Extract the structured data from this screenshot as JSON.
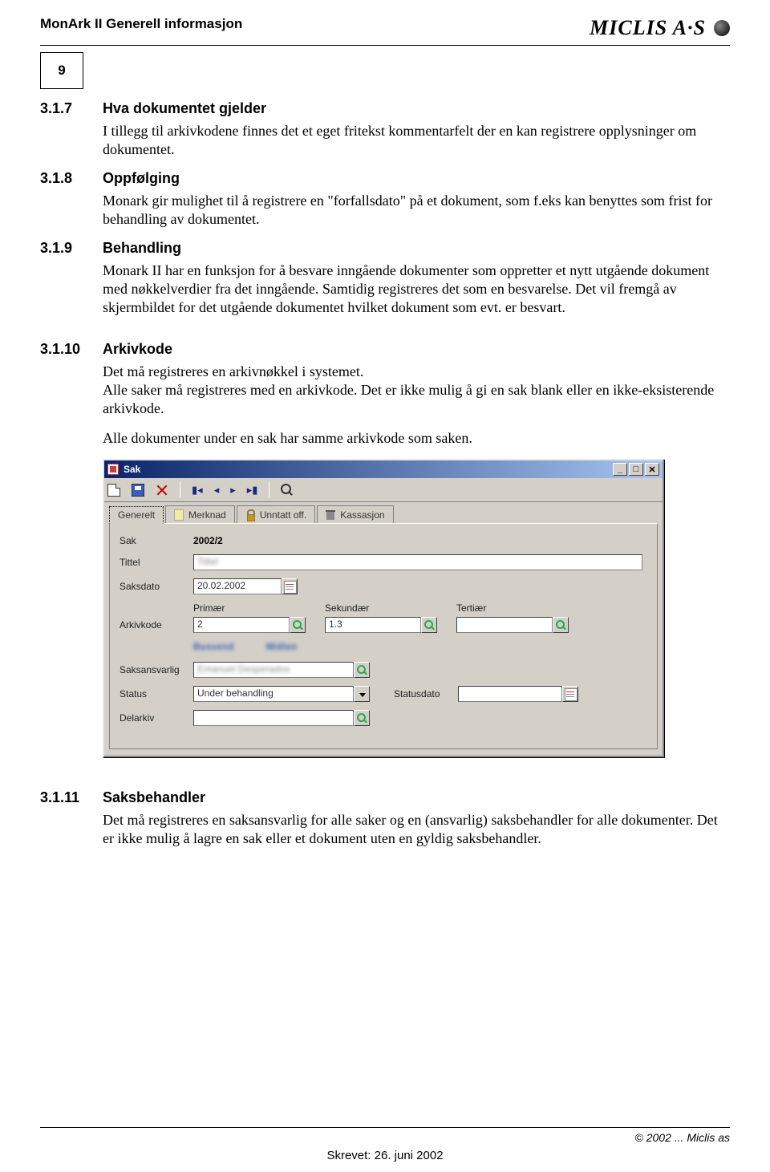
{
  "header": {
    "left": "MonArk II  Generell informasjon",
    "logo_text": "MICLIS A·S",
    "page_number": "9"
  },
  "sections": [
    {
      "num": "3.1.7",
      "title": "Hva dokumentet gjelder",
      "paras": [
        "I tillegg til arkivkodene finnes det et eget fritekst kommentarfelt der en kan registrere opplysninger om dokumentet."
      ]
    },
    {
      "num": "3.1.8",
      "title": "Oppfølging",
      "paras": [
        "Monark gir mulighet til å registrere en \"forfallsdato\" på et dokument, som f.eks kan benyttes som frist for behandling av dokumentet."
      ]
    },
    {
      "num": "3.1.9",
      "title": "Behandling",
      "paras": [
        "Monark II har en funksjon for å besvare inngående dokumenter som oppretter et nytt utgående dokument med nøkkelverdier fra det inngående. Samtidig registreres det som en besvarelse. Det vil fremgå av skjermbildet for det utgående dokumentet hvilket dokument som evt. er besvart."
      ]
    },
    {
      "num": "3.1.10",
      "title": "Arkivkode",
      "paras": [
        "Det må registreres en arkivnøkkel i systemet.",
        "Alle saker må registreres med en arkivkode. Det er ikke mulig å gi en sak blank eller en ikke-eksisterende arkivkode.",
        "Alle dokumenter under en sak har samme arkivkode som saken."
      ]
    },
    {
      "num": "3.1.11",
      "title": "Saksbehandler",
      "paras": [
        "Det må registreres en saksansvarlig for alle saker og en (ansvarlig) saksbehandler for alle dokumenter. Det er ikke mulig å lagre en sak eller et dokument uten en gyldig saksbehandler."
      ]
    }
  ],
  "win": {
    "title": "Sak",
    "tabs": [
      "Generelt",
      "Merknad",
      "Unntatt off.",
      "Kassasjon"
    ],
    "labels": {
      "sak": "Sak",
      "tittel": "Tittel",
      "saksdato": "Saksdato",
      "arkivkode": "Arkivkode",
      "primar": "Primær",
      "sekundar": "Sekundær",
      "tertiar": "Tertiær",
      "saksansvarlig": "Saksansvarlig",
      "status": "Status",
      "statusdato": "Statusdato",
      "delarkiv": "Delarkiv"
    },
    "values": {
      "sak": "2002/2",
      "tittel": "",
      "saksdato": "20.02.2002",
      "primar": "2",
      "sekundar": "1.3",
      "tertiar": "",
      "saksansvarlig": "",
      "status": "Under behandling",
      "statusdato": "",
      "delarkiv": ""
    }
  },
  "footer": {
    "copyright": "© 2002 ... Miclis as",
    "printed": "Skrevet: 26. juni 2002"
  }
}
